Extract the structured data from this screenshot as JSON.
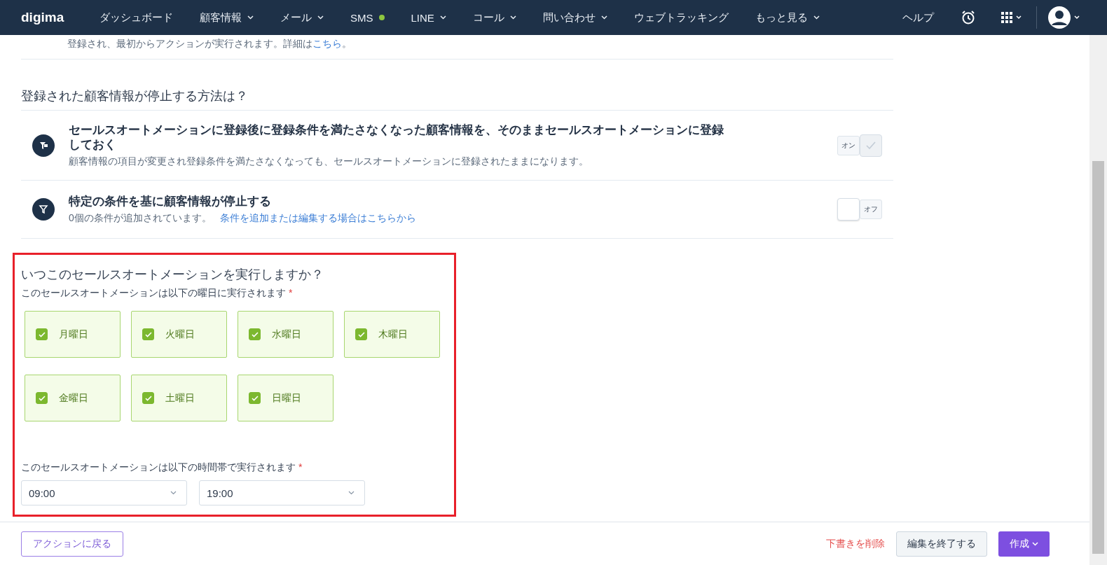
{
  "nav": {
    "logo": "digima",
    "items": [
      {
        "label": "ダッシュボード",
        "dropdown": false,
        "dot": false
      },
      {
        "label": "顧客情報",
        "dropdown": true,
        "dot": false
      },
      {
        "label": "メール",
        "dropdown": true,
        "dot": false
      },
      {
        "label": "SMS",
        "dropdown": false,
        "dot": true
      },
      {
        "label": "LINE",
        "dropdown": true,
        "dot": false
      },
      {
        "label": "コール",
        "dropdown": true,
        "dot": false
      },
      {
        "label": "問い合わせ",
        "dropdown": true,
        "dot": false
      },
      {
        "label": "ウェブトラッキング",
        "dropdown": false,
        "dot": false
      },
      {
        "label": "もっと見る",
        "dropdown": true,
        "dot": false
      }
    ],
    "help": "ヘルプ"
  },
  "partial_row": {
    "description": "登録され、最初からアクションが実行されます。詳細は",
    "link": "こちら",
    "suffix": "。"
  },
  "stop_section": {
    "heading": "登録された顧客情報が停止する方法は？",
    "options": [
      {
        "kind": "keep",
        "title": "セールスオートメーションに登録後に登録条件を満たさなくなった顧客情報を、そのままセールスオートメーションに登録しておく",
        "description": "顧客情報の項目が変更され登録条件を満たさなくなっても、セールスオートメーションに登録されたままになります。",
        "toggle": {
          "label": "オン",
          "on": true
        }
      },
      {
        "kind": "filter",
        "title": "特定の条件を基に顧客情報が停止する",
        "description": "0個の条件が追加されています。",
        "link": "条件を追加または編集する場合はこちらから",
        "toggle": {
          "label": "オフ",
          "on": false
        }
      }
    ]
  },
  "schedule": {
    "heading": "いつこのセールスオートメーションを実行しますか？",
    "days_label": "このセールスオートメーションは以下の曜日に実行されます",
    "required_mark": "*",
    "days": [
      {
        "label": "月曜日",
        "checked": true
      },
      {
        "label": "火曜日",
        "checked": true
      },
      {
        "label": "水曜日",
        "checked": true
      },
      {
        "label": "木曜日",
        "checked": true
      },
      {
        "label": "金曜日",
        "checked": true
      },
      {
        "label": "土曜日",
        "checked": true
      },
      {
        "label": "日曜日",
        "checked": true
      }
    ],
    "time_label": "このセールスオートメーションは以下の時間帯で実行されます",
    "time_required_mark": "*",
    "times": [
      {
        "value": "09:00"
      },
      {
        "value": "19:00"
      }
    ]
  },
  "footer": {
    "back_button": "アクションに戻る",
    "delete_link": "下書きを削除",
    "finish_button": "編集を終了する",
    "create_button": "作成"
  }
}
